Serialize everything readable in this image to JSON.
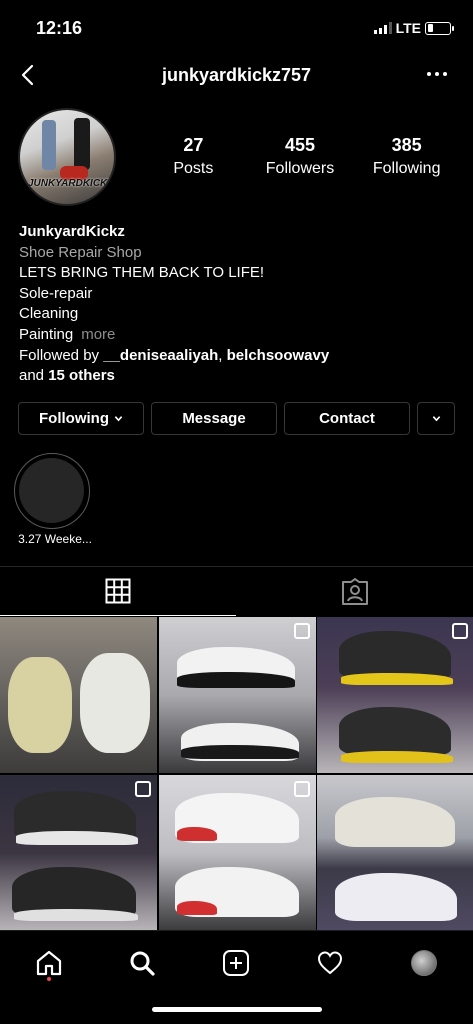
{
  "status": {
    "time": "12:16",
    "network": "LTE",
    "battery_level": 0.25
  },
  "nav": {
    "username": "junkyardkickz757"
  },
  "profile": {
    "avatar_logo_text": "JUNKYARDKICKZ",
    "stats": [
      {
        "value": "27",
        "label": "Posts"
      },
      {
        "value": "455",
        "label": "Followers"
      },
      {
        "value": "385",
        "label": "Following"
      }
    ],
    "name": "JunkyardKickz",
    "category": "Shoe Repair Shop",
    "bio_lines": [
      "LETS BRING THEM BACK TO LIFE!",
      "Sole-repair",
      "Cleaning",
      "Painting"
    ],
    "more_label": "more",
    "followed_by_prefix": "Followed by ",
    "followed_by_user1": "__deniseaaliyah",
    "followed_by_sep": ", ",
    "followed_by_user2": "belchsoowavy",
    "and_label": "and ",
    "others_label": "15 others"
  },
  "buttons": {
    "following": "Following",
    "message": "Message",
    "contact": "Contact"
  },
  "highlights": [
    {
      "label": "3.27 Weeke..."
    }
  ],
  "tabs": [
    {
      "icon": "grid-icon",
      "active": true
    },
    {
      "icon": "tagged-icon",
      "active": false
    }
  ],
  "posts": [
    {
      "description": "worn yellowed soles",
      "multi": false
    },
    {
      "description": "black white concord jordan 11",
      "multi": true
    },
    {
      "description": "black yellow thunder jordan 4",
      "multi": true
    },
    {
      "description": "black cement jordan 3",
      "multi": true
    },
    {
      "description": "white red jordan 3",
      "multi": true
    },
    {
      "description": "white jordan 4",
      "multi": false
    }
  ],
  "bottom_nav": [
    "home-icon",
    "search-icon",
    "add-post-icon",
    "activity-icon",
    "profile-avatar"
  ],
  "colors": {
    "background": "#000000",
    "border": "#363636",
    "secondary_text": "#a8a8a8",
    "notification": "#ed4956"
  }
}
